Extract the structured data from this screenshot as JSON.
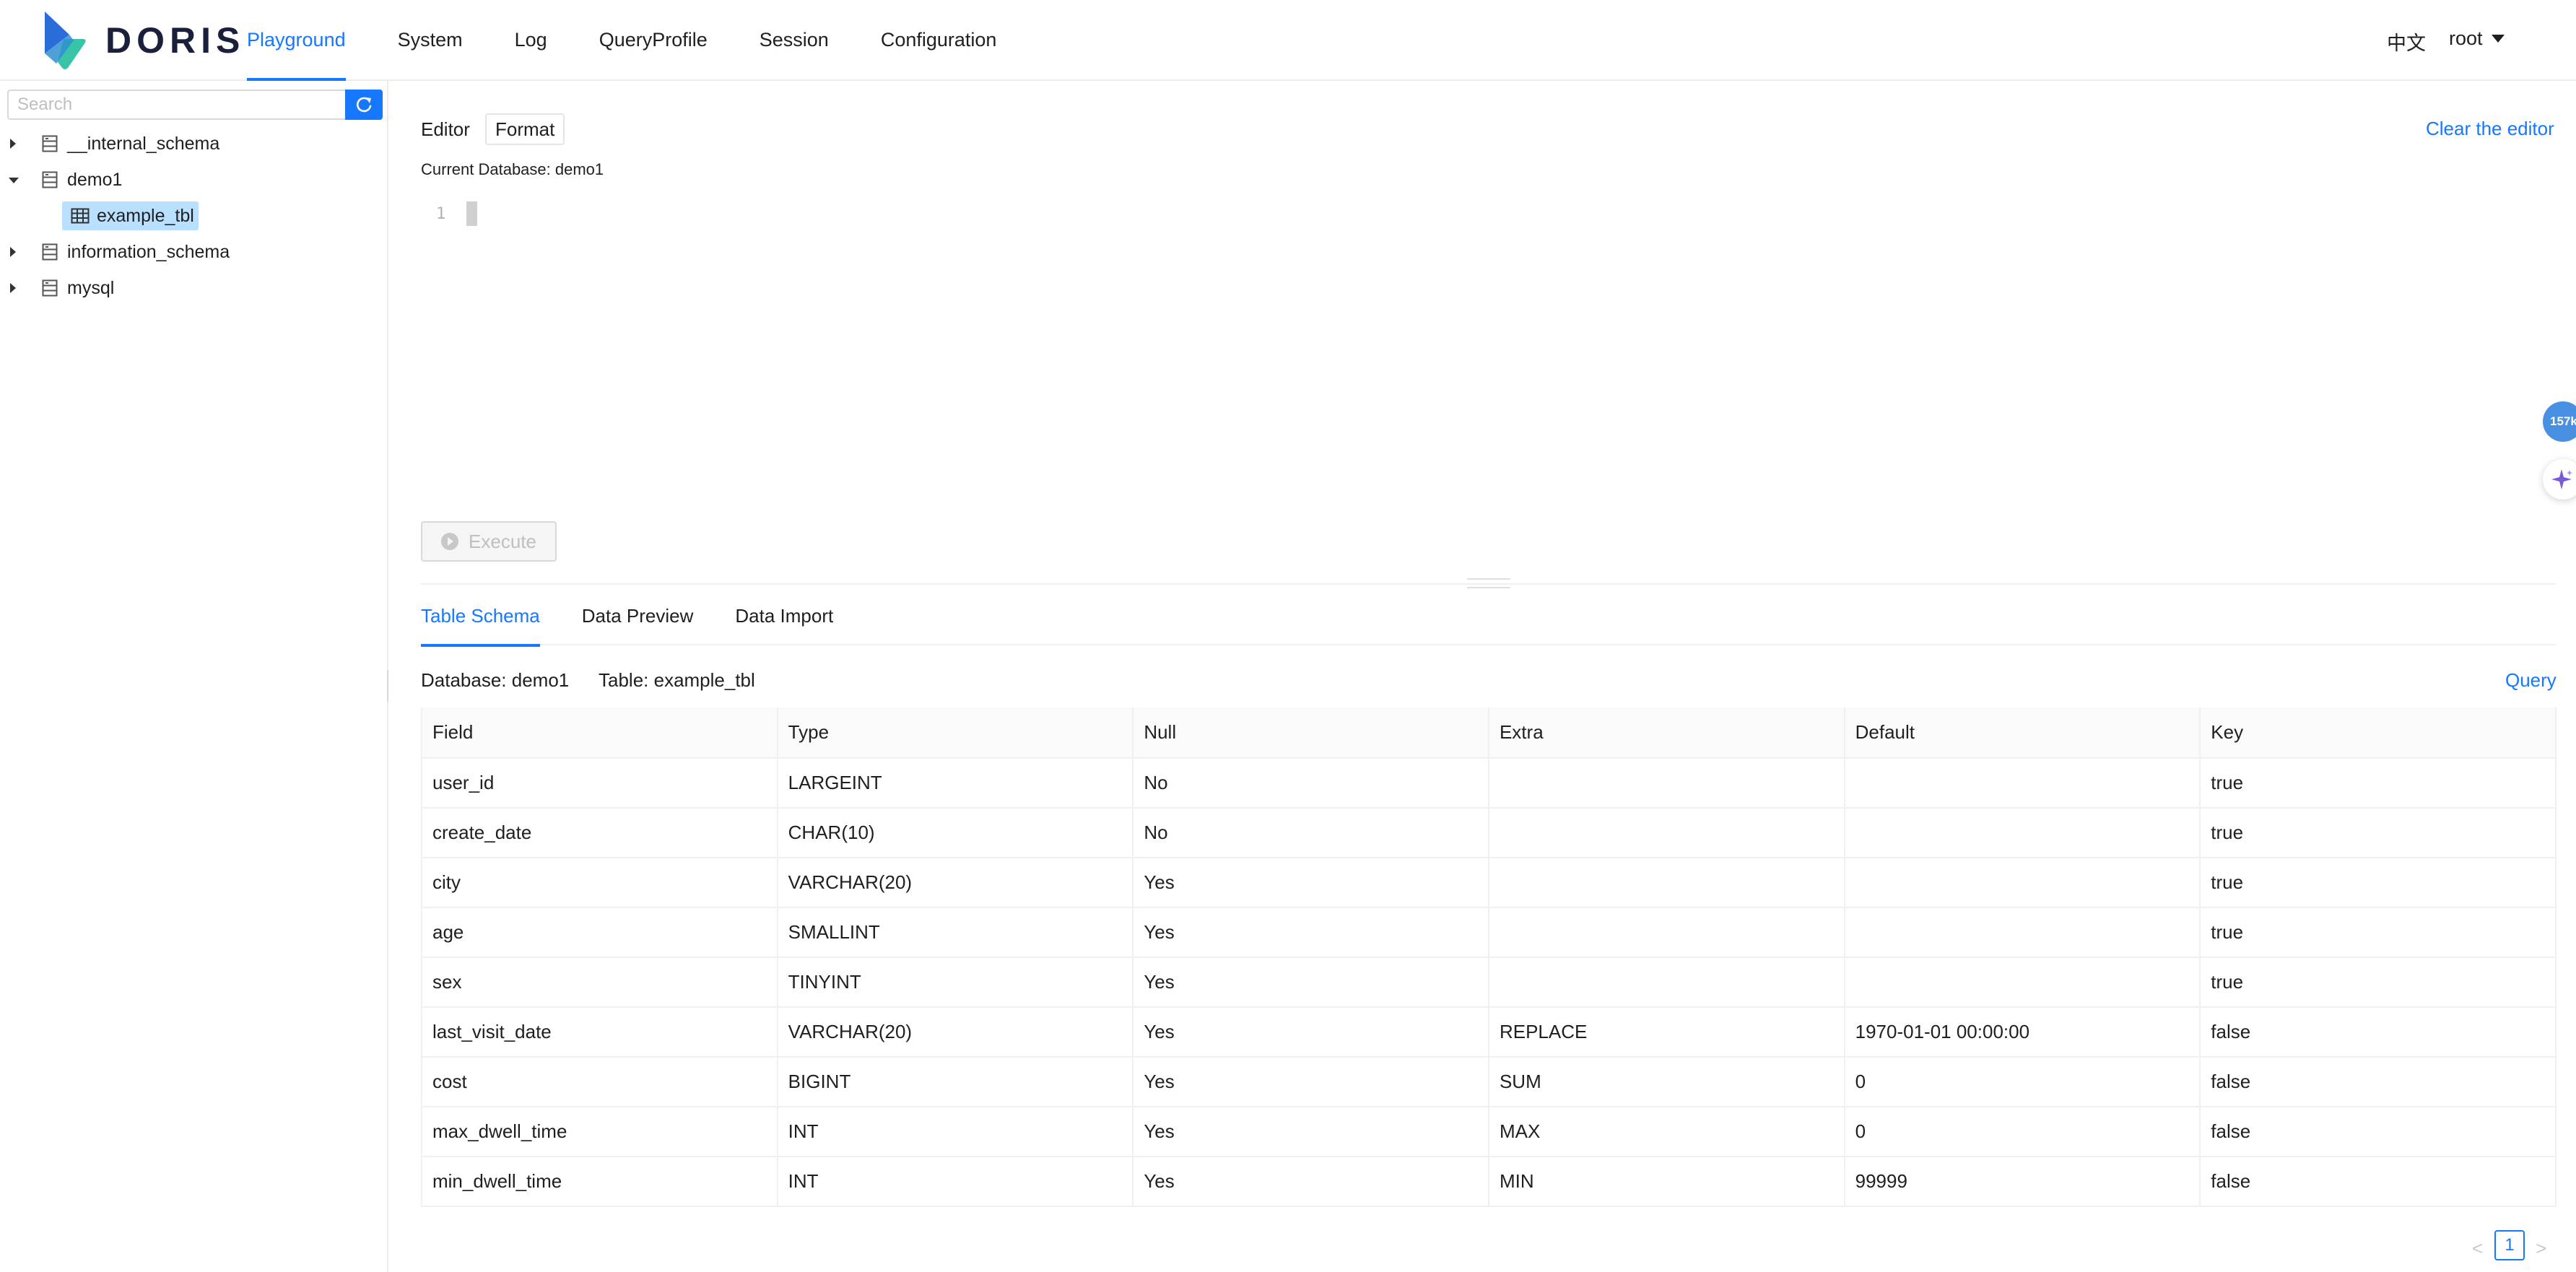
{
  "header": {
    "brand": "DORIS",
    "nav": [
      "Playground",
      "System",
      "Log",
      "QueryProfile",
      "Session",
      "Configuration"
    ],
    "active_nav": "Playground",
    "language": "中文",
    "user": "root",
    "colors": {
      "accent": "#1677ff",
      "logo_blue": "#2a6dd9",
      "logo_teal": "#38c4a6"
    }
  },
  "sidebar": {
    "search_placeholder": "Search",
    "databases": [
      {
        "name": "__internal_schema",
        "expanded": false
      },
      {
        "name": "demo1",
        "expanded": true,
        "tables": [
          "example_tbl"
        ]
      },
      {
        "name": "information_schema",
        "expanded": false
      },
      {
        "name": "mysql",
        "expanded": false
      }
    ],
    "selected_table": "example_tbl"
  },
  "editor": {
    "title": "Editor",
    "format_label": "Format",
    "clear_label": "Clear the editor",
    "current_database": "Current Database: demo1",
    "line_number": "1",
    "execute_label": "Execute"
  },
  "tabs": [
    "Table Schema",
    "Data Preview",
    "Data Import"
  ],
  "active_tab": "Table Schema",
  "schema": {
    "database_label": "Database: demo1",
    "table_label": "Table: example_tbl",
    "query_label": "Query",
    "columns": [
      "Field",
      "Type",
      "Null",
      "Extra",
      "Default",
      "Key"
    ],
    "rows": [
      [
        "user_id",
        "LARGEINT",
        "No",
        "",
        "",
        "true"
      ],
      [
        "create_date",
        "CHAR(10)",
        "No",
        "",
        "",
        "true"
      ],
      [
        "city",
        "VARCHAR(20)",
        "Yes",
        "",
        "",
        "true"
      ],
      [
        "age",
        "SMALLINT",
        "Yes",
        "",
        "",
        "true"
      ],
      [
        "sex",
        "TINYINT",
        "Yes",
        "",
        "",
        "true"
      ],
      [
        "last_visit_date",
        "VARCHAR(20)",
        "Yes",
        "REPLACE",
        "1970-01-01 00:00:00",
        "false"
      ],
      [
        "cost",
        "BIGINT",
        "Yes",
        "SUM",
        "0",
        "false"
      ],
      [
        "max_dwell_time",
        "INT",
        "Yes",
        "MAX",
        "0",
        "false"
      ],
      [
        "min_dwell_time",
        "INT",
        "Yes",
        "MIN",
        "99999",
        "false"
      ]
    ]
  },
  "pagination": {
    "prev": "<",
    "current": "1",
    "next": ">"
  },
  "floating": {
    "badge_text": "157k"
  }
}
